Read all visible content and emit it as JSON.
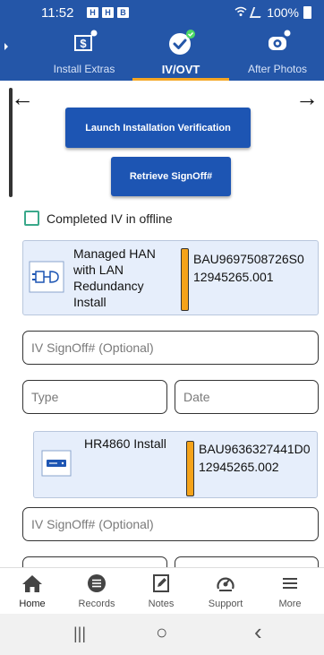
{
  "status_bar": {
    "time": "11:52",
    "notifications": [
      "H",
      "H",
      "B"
    ],
    "battery": "100%"
  },
  "tabs": [
    {
      "label": "Install Extras",
      "icon": "dollar-receipt-icon",
      "active": false
    },
    {
      "label": "IV/OVT",
      "icon": "checkmark-icon",
      "active": true
    },
    {
      "label": "After Photos",
      "icon": "camera-icon",
      "active": false
    }
  ],
  "nav_arrows": {
    "left": "←",
    "right": "→"
  },
  "buttons": {
    "launch": "Launch Installation Verification",
    "retrieve": "Retrieve SignOff#"
  },
  "offline_label": "Completed IV in offline",
  "equipment": [
    {
      "title": "Managed HAN with LAN Redundancy Install",
      "icon": "network-device-icon",
      "serial": "BAU9697508726S0",
      "order": "12945265.001",
      "status_color": "#f5a31a"
    },
    {
      "title": "HR4860 Install",
      "icon": "receiver-box-icon",
      "serial": "BAU9636327441D0",
      "order": "12945265.002",
      "status_color": "#f5a31a"
    }
  ],
  "fields": {
    "signoff_placeholder": "IV SignOff# (Optional)",
    "type_placeholder": "Type",
    "date_placeholder": "Date"
  },
  "bottom_nav": [
    {
      "label": "Home",
      "icon": "home-icon",
      "active": true
    },
    {
      "label": "Records",
      "icon": "records-icon",
      "active": false
    },
    {
      "label": "Notes",
      "icon": "notes-icon",
      "active": false
    },
    {
      "label": "Support",
      "icon": "support-icon",
      "active": false
    },
    {
      "label": "More",
      "icon": "menu-icon",
      "active": false
    }
  ],
  "system_nav": {
    "recents": "|||",
    "home": "○",
    "back": "‹"
  },
  "colors": {
    "header": "#2456a8",
    "button": "#1d55b3",
    "tab_underline": "#f5a623",
    "status_pending": "#f5a31a",
    "card_bg": "#e6eefb"
  }
}
